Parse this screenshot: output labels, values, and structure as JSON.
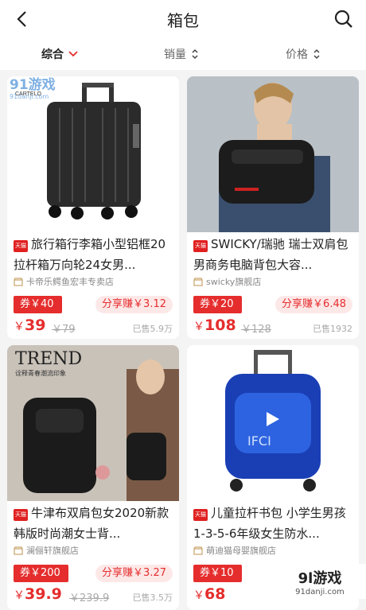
{
  "header": {
    "title": "箱包",
    "back_icon": "chevron-left-icon",
    "search_icon": "search-icon"
  },
  "sort": [
    {
      "label": "综合",
      "active": true
    },
    {
      "label": "销量",
      "active": false
    },
    {
      "label": "价格",
      "active": false
    }
  ],
  "products": [
    {
      "name": "旅行箱行李箱小型铝框20拉杆箱万向轮24女男...",
      "badge": "天猫",
      "shop": "卡帝乐鳄鱼宏丰专卖店",
      "coupon": "券￥40",
      "share": "分享赚￥3.12",
      "price_symbol": "￥",
      "price": "39",
      "original_price": "￥79",
      "sold": "已售5.9万"
    },
    {
      "name": "SWICKY/瑞驰 瑞士双肩包男商务电脑背包大容...",
      "badge": "天猫",
      "shop": "swicky旗舰店",
      "coupon": "券￥20",
      "share": "分享赚￥6.48",
      "price_symbol": "￥",
      "price": "108",
      "original_price": "￥128",
      "sold": "已售1932"
    },
    {
      "name": "牛津布双肩包女2020新款韩版时尚潮女士背...",
      "badge": "天猫",
      "shop": "澜俪轩旗舰店",
      "coupon": "券￥200",
      "share": "分享赚￥3.27",
      "price_symbol": "￥",
      "price": "39.9",
      "original_price": "￥239.9",
      "sold": "已售3.5万"
    },
    {
      "name": "儿童拉杆书包 小学生男孩1-3-5-6年级女生防水...",
      "badge": "天猫",
      "shop": "萌迪猫母婴旗舰店",
      "coupon": "券￥10",
      "share": "",
      "price_symbol": "￥",
      "price": "68",
      "original_price": "",
      "sold": ""
    }
  ],
  "image_texts": {
    "trend": "TREND",
    "trend_sub": "诠释青春潮流印象",
    "suitcase_brand": "CARTELO",
    "blue_bag_text": "IFCI"
  },
  "watermark": {
    "main": "9l游戏",
    "sub": "91danji.com",
    "top_main": "91游戏",
    "top_sub": "91danji.com"
  },
  "colors": {
    "accent": "#e52d2d",
    "coupon_bg": "#e52d2d",
    "share_bg": "#fde8e8"
  }
}
